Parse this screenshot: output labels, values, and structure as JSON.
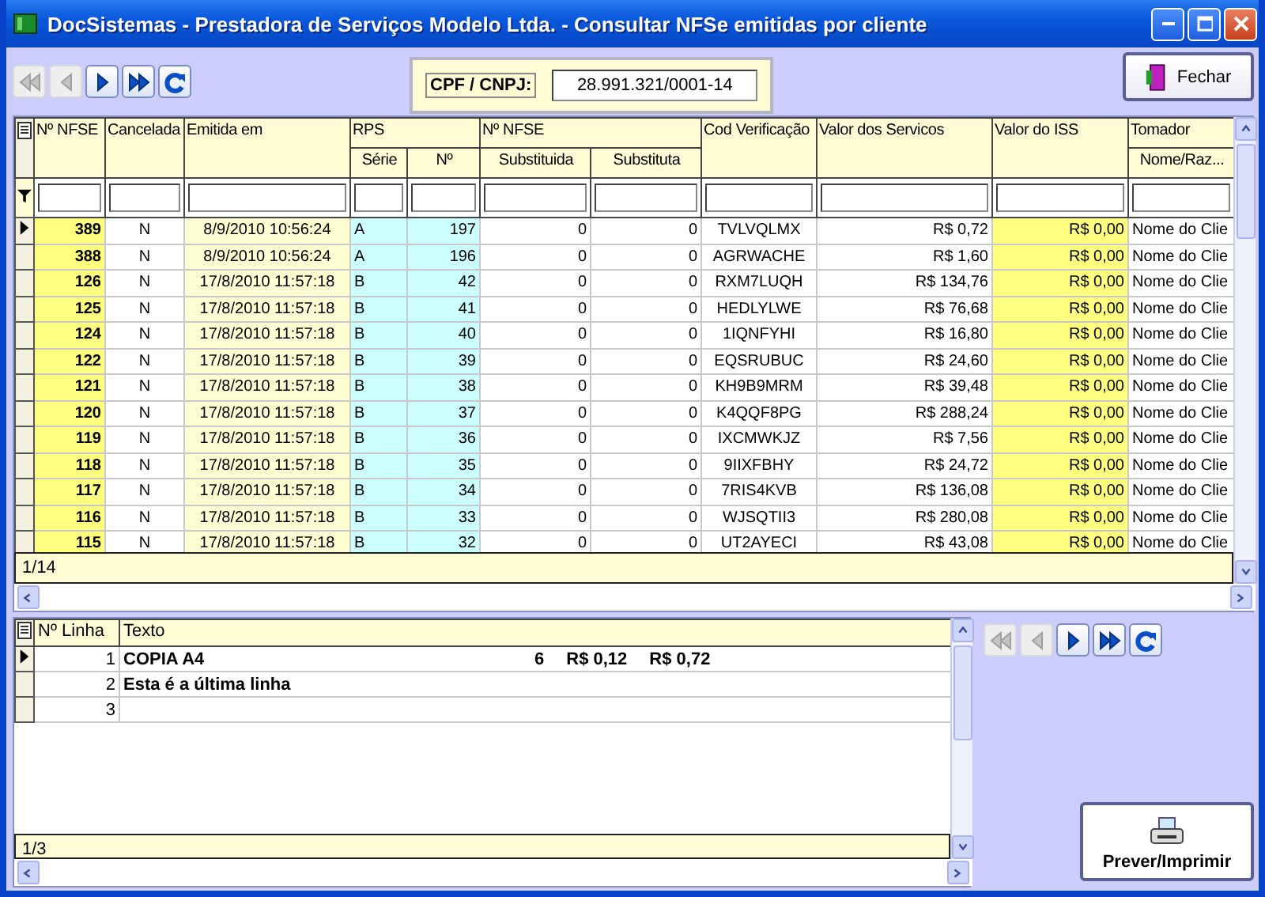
{
  "window": {
    "title": "DocSistemas - Prestadora de Serviços Modelo Ltda. - Consultar NFSe emitidas por cliente"
  },
  "top_navigator": [
    {
      "kind": "first",
      "disabled": true
    },
    {
      "kind": "prior",
      "disabled": true
    },
    {
      "kind": "next",
      "disabled": false
    },
    {
      "kind": "last",
      "disabled": false
    },
    {
      "kind": "refresh",
      "disabled": false
    }
  ],
  "cpf_filter": {
    "label": "CPF / CNPJ:",
    "value": "28.991.321/0001-14"
  },
  "close_button": {
    "label": "Fechar"
  },
  "main_grid": {
    "columns": [
      {
        "label": "Nº NFSE"
      },
      {
        "label": "Cancelada"
      },
      {
        "label": "Emitida em"
      },
      {
        "label": "RPS",
        "colspan": 2,
        "children": [
          {
            "label": "Série"
          },
          {
            "label": "Nº"
          }
        ]
      },
      {
        "label": "Nº NFSE",
        "colspan": 2,
        "children": [
          {
            "label": "Substituida"
          },
          {
            "label": "Substituta"
          }
        ]
      },
      {
        "label": "Cod Verificação"
      },
      {
        "label": "Valor dos Servicos"
      },
      {
        "label": "Valor do ISS"
      },
      {
        "label": "Tomador",
        "children": [
          {
            "label": "Nome/Raz..."
          }
        ]
      }
    ],
    "rows": [
      {
        "selected": true,
        "cells": [
          "389",
          "N",
          "8/9/2010 10:56:24",
          "A",
          "197",
          "0",
          "0",
          "TVLVQLMX",
          "R$ 0,72",
          "R$ 0,00",
          "Nome do Clie"
        ]
      },
      {
        "selected": false,
        "cells": [
          "388",
          "N",
          "8/9/2010 10:56:24",
          "A",
          "196",
          "0",
          "0",
          "AGRWACHE",
          "R$ 1,60",
          "R$ 0,00",
          "Nome do Clie"
        ]
      },
      {
        "selected": false,
        "cells": [
          "126",
          "N",
          "17/8/2010 11:57:18",
          "B",
          "42",
          "0",
          "0",
          "RXM7LUQH",
          "R$ 134,76",
          "R$ 0,00",
          "Nome do Clie"
        ]
      },
      {
        "selected": false,
        "cells": [
          "125",
          "N",
          "17/8/2010 11:57:18",
          "B",
          "41",
          "0",
          "0",
          "HEDLYLWE",
          "R$ 76,68",
          "R$ 0,00",
          "Nome do Clie"
        ]
      },
      {
        "selected": false,
        "cells": [
          "124",
          "N",
          "17/8/2010 11:57:18",
          "B",
          "40",
          "0",
          "0",
          "1IQNFYHI",
          "R$ 16,80",
          "R$ 0,00",
          "Nome do Clie"
        ]
      },
      {
        "selected": false,
        "cells": [
          "122",
          "N",
          "17/8/2010 11:57:18",
          "B",
          "39",
          "0",
          "0",
          "EQSRUBUC",
          "R$ 24,60",
          "R$ 0,00",
          "Nome do Clie"
        ]
      },
      {
        "selected": false,
        "cells": [
          "121",
          "N",
          "17/8/2010 11:57:18",
          "B",
          "38",
          "0",
          "0",
          "KH9B9MRM",
          "R$ 39,48",
          "R$ 0,00",
          "Nome do Clie"
        ]
      },
      {
        "selected": false,
        "cells": [
          "120",
          "N",
          "17/8/2010 11:57:18",
          "B",
          "37",
          "0",
          "0",
          "K4QQF8PG",
          "R$ 288,24",
          "R$ 0,00",
          "Nome do Clie"
        ]
      },
      {
        "selected": false,
        "cells": [
          "119",
          "N",
          "17/8/2010 11:57:18",
          "B",
          "36",
          "0",
          "0",
          "IXCMWKJZ",
          "R$ 7,56",
          "R$ 0,00",
          "Nome do Clie"
        ]
      },
      {
        "selected": false,
        "cells": [
          "118",
          "N",
          "17/8/2010 11:57:18",
          "B",
          "35",
          "0",
          "0",
          "9IIXFBHY",
          "R$ 24,72",
          "R$ 0,00",
          "Nome do Clie"
        ]
      },
      {
        "selected": false,
        "cells": [
          "117",
          "N",
          "17/8/2010 11:57:18",
          "B",
          "34",
          "0",
          "0",
          "7RIS4KVB",
          "R$ 136,08",
          "R$ 0,00",
          "Nome do Clie"
        ]
      },
      {
        "selected": false,
        "cells": [
          "116",
          "N",
          "17/8/2010 11:57:18",
          "B",
          "33",
          "0",
          "0",
          "WJSQTII3",
          "R$ 280,08",
          "R$ 0,00",
          "Nome do Clie"
        ]
      },
      {
        "selected": false,
        "cells": [
          "115",
          "N",
          "17/8/2010 11:57:18",
          "B",
          "32",
          "0",
          "0",
          "UT2AYECI",
          "R$ 43,08",
          "R$ 0,00",
          "Nome do Clie"
        ]
      }
    ],
    "status": "1/14"
  },
  "lines_grid": {
    "columns": [
      {
        "label": "Nº Linha"
      },
      {
        "label": "Texto"
      }
    ],
    "rows": [
      {
        "selected": true,
        "number": "1",
        "text": "COPIA A4",
        "amounts": [
          "6",
          "R$ 0,12",
          "R$ 0,72"
        ]
      },
      {
        "selected": false,
        "number": "2",
        "text": "Esta é a última linha"
      },
      {
        "selected": false,
        "number": "3"
      }
    ],
    "status": "1/3"
  },
  "bottom_navigator": [
    {
      "kind": "first",
      "disabled": true
    },
    {
      "kind": "prior",
      "disabled": true
    },
    {
      "kind": "next",
      "disabled": false
    },
    {
      "kind": "last",
      "disabled": false
    },
    {
      "kind": "refresh",
      "disabled": false
    }
  ],
  "print_button": {
    "label": "Prever/Imprimir"
  }
}
